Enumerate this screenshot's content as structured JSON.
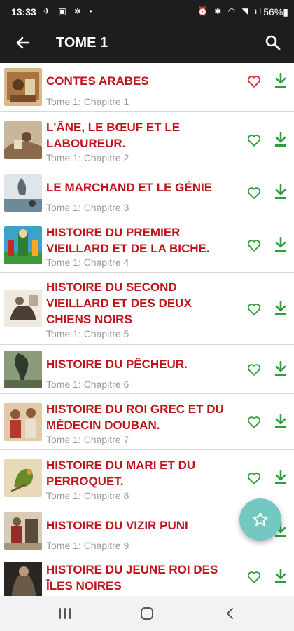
{
  "status_bar": {
    "time": "13:33",
    "left_icons": "✈ ▣ ✲ •",
    "right_icons": "⏰ ✱ ◠ ◥ ıl",
    "battery": "56%▮"
  },
  "app_bar": {
    "title": "TOME 1"
  },
  "colors": {
    "title_red": "#c0141c",
    "icon_green": "#2e9d3a",
    "heart_red": "#d32f2f",
    "fab_teal": "#75c8c1",
    "bar_dark": "#1d1d1d"
  },
  "chapters": [
    {
      "title": "CONTES ARABES",
      "subtitle": "Tome 1: Chapitre 1",
      "favorite_icon": "heart-outline-red"
    },
    {
      "title": "L'ÂNE, LE BŒUF ET LE LABOUREUR.",
      "subtitle": "Tome 1: Chapitre 2",
      "favorite_icon": "heart-outline-green"
    },
    {
      "title": "LE MARCHAND ET LE GÉNIE",
      "subtitle": "Tome 1: Chapitre 3",
      "favorite_icon": "heart-outline-green"
    },
    {
      "title": "HISTOIRE DU PREMIER VIEILLARD ET DE LA BICHE.",
      "subtitle": "Tome 1: Chapitre 4",
      "favorite_icon": "heart-outline-green"
    },
    {
      "title": "HISTOIRE DU SECOND VIEILLARD ET DES DEUX CHIENS NOIRS",
      "subtitle": "Tome 1: Chapitre 5",
      "favorite_icon": "heart-outline-green"
    },
    {
      "title": "HISTOIRE DU PÊCHEUR.",
      "subtitle": "Tome 1: Chapitre 6",
      "favorite_icon": "heart-outline-green"
    },
    {
      "title": "HISTOIRE DU ROI GREC ET DU MÉDECIN DOUBAN.",
      "subtitle": "Tome 1: Chapitre 7",
      "favorite_icon": "heart-outline-green"
    },
    {
      "title": "HISTOIRE DU MARI ET DU PERROQUET.",
      "subtitle": "Tome 1: Chapitre 8",
      "favorite_icon": "heart-outline-green"
    },
    {
      "title": "HISTOIRE DU VIZIR PUNI",
      "subtitle": "Tome 1: Chapitre 9",
      "favorite_icon": "heart-outline-green"
    },
    {
      "title": "HISTOIRE DU JEUNE ROI DES ÎLES NOIRES",
      "subtitle": "",
      "favorite_icon": "heart-outline-green"
    }
  ]
}
